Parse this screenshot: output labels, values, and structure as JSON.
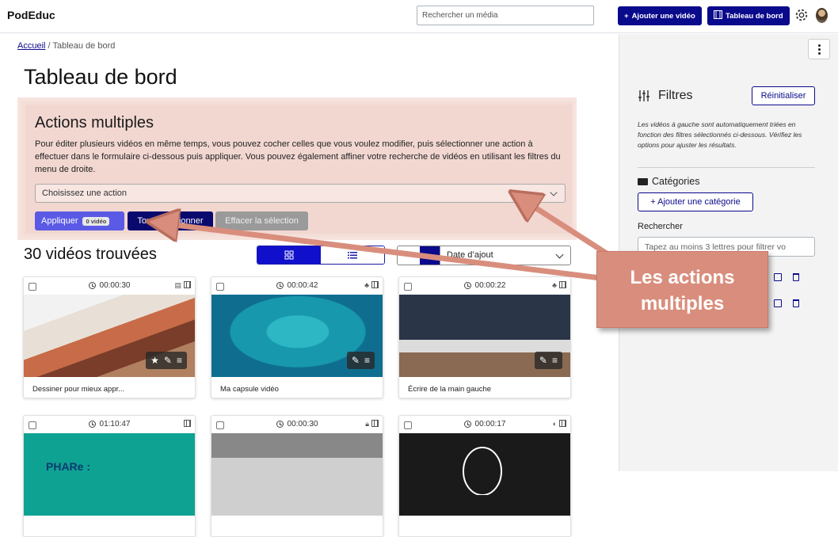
{
  "header": {
    "brand": "PodEduc",
    "search_placeholder": "Rechercher un média",
    "add_video_label": "Ajouter une vidéo",
    "dashboard_label": "Tableau de bord"
  },
  "breadcrumb": {
    "home": "Accueil",
    "separator": "/",
    "current": "Tableau de bord"
  },
  "page_title": "Tableau de bord",
  "actions": {
    "title": "Actions multiples",
    "description": "Pour éditer plusieurs vidéos en même temps, vous pouvez cocher celles que vous voulez modifier, puis sélectionner une action à effectuer dans le formulaire ci-dessous puis appliquer. Vous pouvez également affiner votre recherche de vidéos en utilisant les filtres du menu de droite.",
    "select_value": "Choisissez une action",
    "apply_label": "Appliquer",
    "apply_badge": "0 vidéo",
    "select_all_label": "Tout sélectionner",
    "clear_label": "Effacer la sélection"
  },
  "results": {
    "count_label": "30 vidéos trouvées",
    "sort_value": "Date d’ajout"
  },
  "videos": [
    {
      "duration": "00:00:30",
      "title": "Dessiner pour mieux appr..."
    },
    {
      "duration": "00:00:42",
      "title": "Ma capsule vidéo"
    },
    {
      "duration": "00:00:22",
      "title": "Écrire de la main gauche"
    },
    {
      "duration": "01:10:47",
      "title": "",
      "thumb_text": "PHARe :"
    },
    {
      "duration": "00:00:30",
      "title": ""
    },
    {
      "duration": "00:00:17",
      "title": ""
    }
  ],
  "sidebar": {
    "filters_title": "Filtres",
    "reset_label": "Réinitialiser",
    "note": "Les vidéos à gauche sont automatiquement triées en fonction des filtres sélectionnés ci-dessous. Vérifiez les options pour ajuster les résultats.",
    "categories_title": "Catégories",
    "add_category_label": "+ Ajouter une catégorie",
    "search_label": "Rechercher",
    "search_placeholder": "Tapez au moins 3 lettres pour filtrer vo"
  },
  "callout": {
    "line1": "Les actions",
    "line2": "multiples"
  },
  "colors": {
    "navy": "#0a0a8c",
    "callout": "#d98e7d",
    "actions_bg": "#f2d7d1"
  }
}
